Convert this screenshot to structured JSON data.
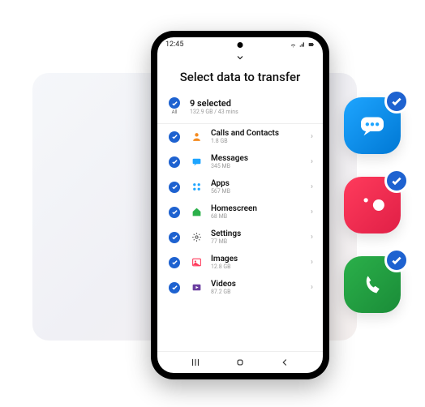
{
  "statusbar": {
    "time": "12:45"
  },
  "title": "Select data to transfer",
  "summary": {
    "selected": "9 selected",
    "meta": "132.9 GB / 43 mins",
    "all_label": "All"
  },
  "items": [
    {
      "label": "Calls and Contacts",
      "size": "1.8 GB",
      "icon": "contact",
      "color": "#f58b1f"
    },
    {
      "label": "Messages",
      "size": "345 MB",
      "icon": "message",
      "color": "#1ea5ff"
    },
    {
      "label": "Apps",
      "size": "567 MB",
      "icon": "apps",
      "color": "#1ea5ff"
    },
    {
      "label": "Homescreen",
      "size": "68 MB",
      "icon": "home",
      "color": "#2bb04a"
    },
    {
      "label": "Settings",
      "size": "77 MB",
      "icon": "settings",
      "color": "#555"
    },
    {
      "label": "Images",
      "size": "12.8 GB",
      "icon": "image",
      "color": "#ff3b5c"
    },
    {
      "label": "Videos",
      "size": "87.2 GB",
      "icon": "video",
      "color": "#6b3fa0"
    }
  ],
  "side_apps": [
    {
      "name": "messages-app",
      "kind": "msg",
      "checked": true
    },
    {
      "name": "camera-app",
      "kind": "cam",
      "checked": true
    },
    {
      "name": "phone-app",
      "kind": "phone",
      "checked": true
    }
  ]
}
